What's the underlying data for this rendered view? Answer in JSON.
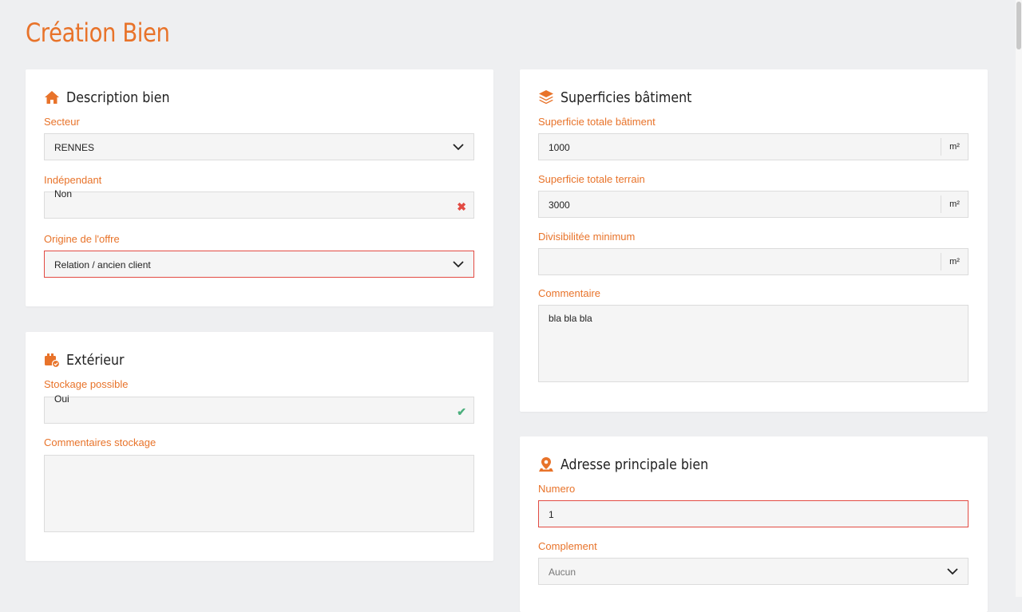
{
  "page": {
    "title": "Création Bien"
  },
  "colors": {
    "accent": "#e8732a",
    "error": "#e24b43",
    "success": "#4caf7d"
  },
  "description": {
    "title": "Description bien",
    "icon": "home-icon",
    "secteur": {
      "label": "Secteur",
      "value": "RENNES"
    },
    "independant": {
      "label": "Indépendant",
      "value": "Non"
    },
    "origine": {
      "label": "Origine de l'offre",
      "value": "Relation / ancien client"
    }
  },
  "exterieur": {
    "title": "Extérieur",
    "icon": "storage-icon",
    "stockage": {
      "label": "Stockage possible",
      "value": "Oui"
    },
    "commentaires": {
      "label": "Commentaires stockage",
      "value": ""
    }
  },
  "superficies": {
    "title": "Superficies bâtiment",
    "icon": "layers-icon",
    "totale_batiment": {
      "label": "Superficie totale bâtiment",
      "value": "1000",
      "unit": "m²"
    },
    "totale_terrain": {
      "label": "Superficie totale terrain",
      "value": "3000",
      "unit": "m²"
    },
    "divisibilite": {
      "label": "Divisibilitée minimum",
      "value": "",
      "unit": "m²"
    },
    "commentaire": {
      "label": "Commentaire",
      "value": "bla bla bla"
    }
  },
  "adresse": {
    "title": "Adresse principale bien",
    "icon": "map-pin-icon",
    "numero": {
      "label": "Numero",
      "value": "1"
    },
    "complement": {
      "label": "Complement",
      "value": "Aucun"
    }
  }
}
